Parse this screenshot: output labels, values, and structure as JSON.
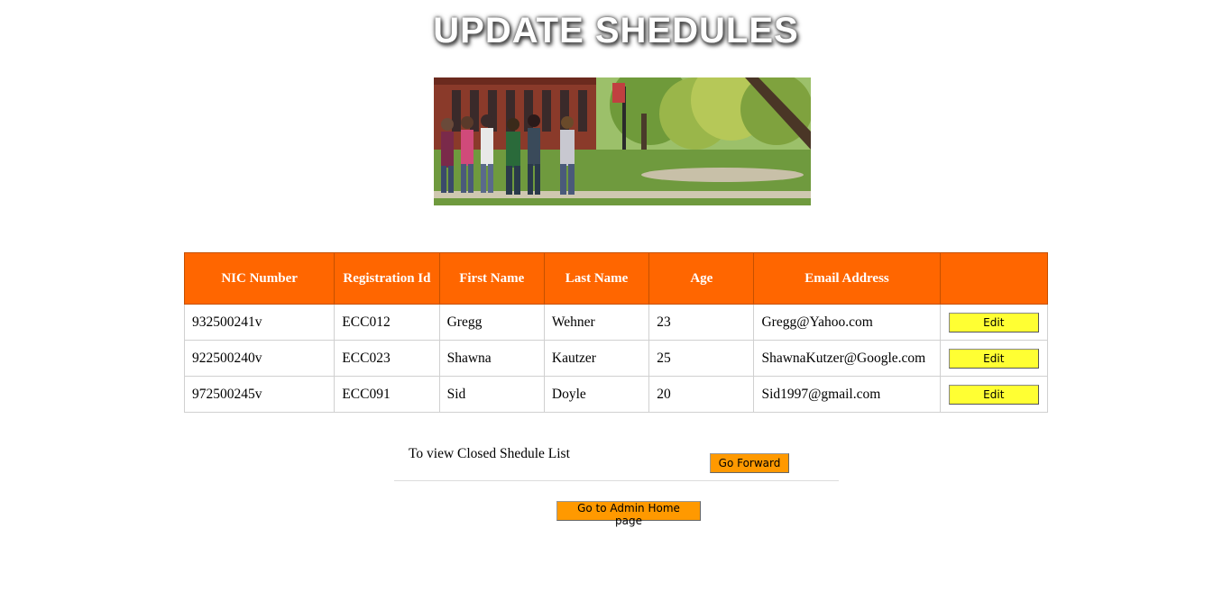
{
  "page": {
    "title": "UPDATE SHEDULES"
  },
  "table": {
    "headers": [
      "NIC Number",
      "Registration Id",
      "First Name",
      "Last Name",
      "Age",
      "Email Address",
      ""
    ],
    "rows": [
      {
        "nic": "932500241v",
        "reg_id": "ECC012",
        "first_name": "Gregg",
        "last_name": "Wehner",
        "age": "23",
        "email": "Gregg@Yahoo.com",
        "action": "Edit"
      },
      {
        "nic": "922500240v",
        "reg_id": "ECC023",
        "first_name": "Shawna",
        "last_name": "Kautzer",
        "age": "25",
        "email": "ShawnaKutzer@Google.com",
        "action": "Edit"
      },
      {
        "nic": "972500245v",
        "reg_id": "ECC091",
        "first_name": "Sid",
        "last_name": "Doyle",
        "age": "20",
        "email": "Sid1997@gmail.com",
        "action": "Edit"
      }
    ]
  },
  "closed": {
    "label": "To view Closed Shedule List",
    "button": "Go Forward"
  },
  "admin": {
    "button": "Go to Admin Home page"
  },
  "colors": {
    "header_bg": "#ff6600",
    "edit_button": "#ffff33",
    "nav_button": "#ff9900"
  }
}
